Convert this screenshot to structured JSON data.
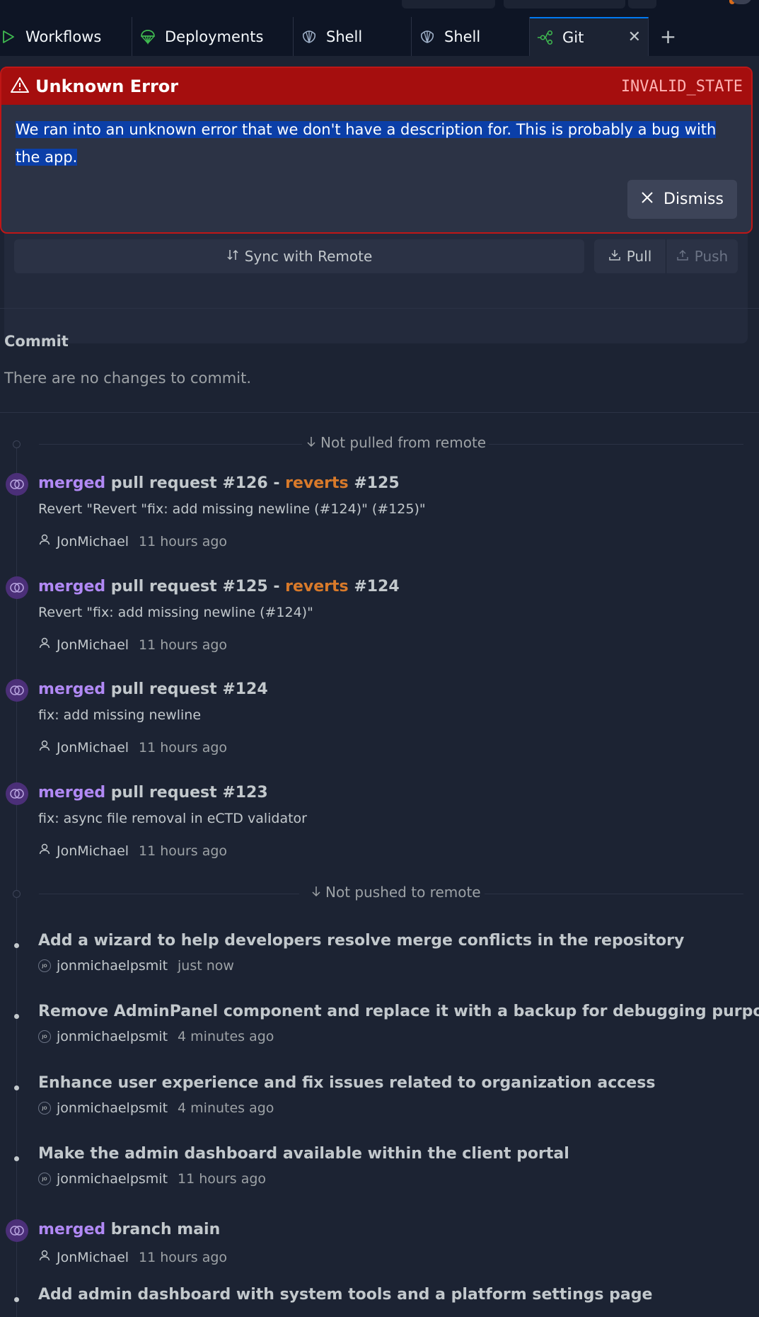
{
  "tabs": [
    {
      "label": "Workflows",
      "icon": "play-icon"
    },
    {
      "label": "Deployments",
      "icon": "deployments-icon"
    },
    {
      "label": "Shell",
      "icon": "shell-icon"
    },
    {
      "label": "Shell",
      "icon": "shell-icon"
    },
    {
      "label": "Git",
      "icon": "git-icon",
      "active": true
    }
  ],
  "error": {
    "title": "Unknown Error",
    "code": "INVALID_STATE",
    "message": "We ran into an unknown error that we don't have a description for. This is probably a bug with the app.",
    "dismiss_label": "Dismiss"
  },
  "remote": {
    "sync_label": "Sync with Remote",
    "pull_label": "Pull",
    "push_label": "Push"
  },
  "commit": {
    "title": "Commit",
    "empty_text": "There are no changes to commit."
  },
  "history": {
    "not_pulled_label": "Not pulled from remote",
    "not_pushed_label": "Not pushed to remote",
    "pulled": [
      {
        "merged": "merged",
        "title": "pull request #126 - ",
        "reverts": "reverts",
        "ref": "#125",
        "subtitle": "Revert \"Revert \"fix: add missing newline (#124)\" (#125)\"",
        "author": "JonMichael",
        "time": "11 hours ago"
      },
      {
        "merged": "merged",
        "title": "pull request #125 - ",
        "reverts": "reverts",
        "ref": "#124",
        "subtitle": "Revert \"fix: add missing newline (#124)\"",
        "author": "JonMichael",
        "time": "11 hours ago"
      },
      {
        "merged": "merged",
        "title": "pull request #124",
        "subtitle": "fix: add missing newline",
        "author": "JonMichael",
        "time": "11 hours ago"
      },
      {
        "merged": "merged",
        "title": "pull request #123",
        "subtitle": "fix: async file removal in eCTD validator",
        "author": "JonMichael",
        "time": "11 hours ago"
      }
    ],
    "pushed": [
      {
        "title": "Add a wizard to help developers resolve merge conflicts in the repository",
        "author": "jonmichaelpsmit",
        "time": "just now",
        "avatar": "JO"
      },
      {
        "title": "Remove AdminPanel component and replace it with a backup for debugging purposes",
        "author": "jonmichaelpsmit",
        "time": "4 minutes ago",
        "avatar": "JO"
      },
      {
        "title": "Enhance user experience and fix issues related to organization access",
        "author": "jonmichaelpsmit",
        "time": "4 minutes ago",
        "avatar": "JO"
      },
      {
        "title": "Make the admin dashboard available within the client portal",
        "author": "jonmichaelpsmit",
        "time": "11 hours ago",
        "avatar": "JO"
      }
    ],
    "merge_branch": {
      "merged": "merged",
      "title": "branch main",
      "author": "JonMichael",
      "time": "11 hours ago"
    },
    "last": {
      "title": "Add admin dashboard with system tools and a platform settings page"
    }
  }
}
